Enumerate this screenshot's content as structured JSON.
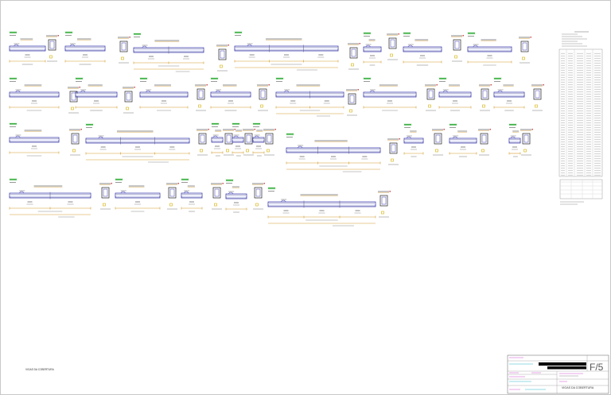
{
  "sheet": {
    "view_caption": "VIGAS DA COBERTURA",
    "title_block": {
      "sheet_number": "F/5",
      "drawing_title": "VIGAS DA COBERTURA"
    }
  },
  "colors": {
    "background": "#ffffff",
    "label": "#3cb043",
    "rebar": "#3a3ab0",
    "beam_edge": "#55558a",
    "beam_fill": "#eef0ff",
    "dimension": "#d69a2c",
    "section": "#222222",
    "marker": "#d4b000",
    "text_mark": "#8a8a8a",
    "accent_red": "#d24a4a",
    "title_block_magenta": "#d04fd0",
    "title_block_cyan": "#2ab7c9",
    "redaction": "#000000"
  }
}
